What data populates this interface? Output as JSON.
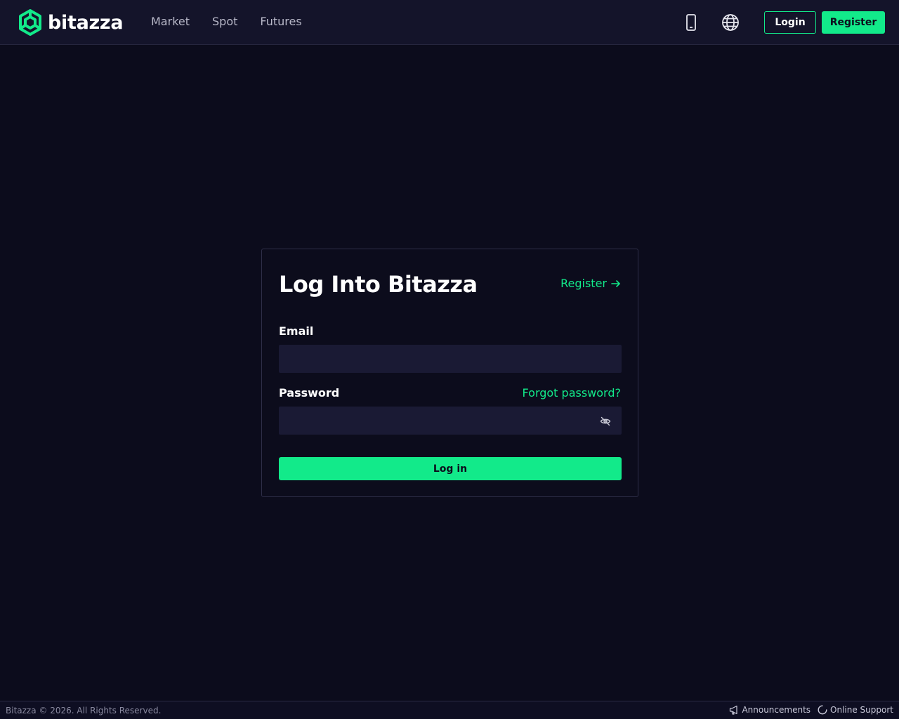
{
  "brand": {
    "name": "bitazza",
    "accent_color": "#12ea8a",
    "logo_icon": "bitazza-logo-icon"
  },
  "nav": {
    "items": [
      {
        "label": "Market"
      },
      {
        "label": "Spot"
      },
      {
        "label": "Futures"
      }
    ]
  },
  "header": {
    "mobile_icon": "mobile-phone-icon",
    "language_icon": "globe-icon",
    "login_label": "Login",
    "register_label": "Register"
  },
  "login_form": {
    "title": "Log Into Bitazza",
    "register_link": "Register",
    "email_label": "Email",
    "email_value": "",
    "password_label": "Password",
    "password_value": "",
    "forgot_link": "Forgot password?",
    "submit_label": "Log in",
    "toggle_visibility_icon": "eye-slash-icon"
  },
  "footer": {
    "copyright": "Bitazza © 2026. All Rights Reserved.",
    "announcements_label": "Announcements",
    "announcements_icon": "megaphone-icon",
    "support_label": "Online Support",
    "support_icon": "loading-spinner-icon"
  }
}
